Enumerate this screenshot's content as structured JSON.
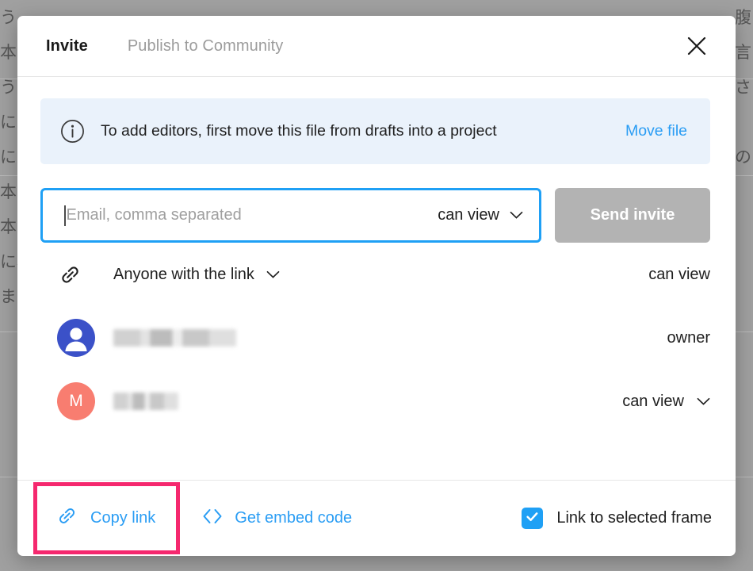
{
  "backdrop": {
    "left_text": "う\n本え\nう\nに口\nにい\n本\n本自\nに、\nま",
    "right_text": "腹\n言\nさ\n\nの",
    "overlay_color": "#a0a0a0"
  },
  "dialog": {
    "tabs": [
      {
        "label": "Invite",
        "active": true
      },
      {
        "label": "Publish to Community",
        "active": false
      }
    ],
    "close_label": "Close",
    "banner": {
      "icon": "info-icon",
      "text": "To add editors, first move this file from drafts into a project",
      "link_label": "Move file",
      "background": "#eaf2fb",
      "link_color": "#2a9df4"
    },
    "invite": {
      "placeholder": "Email, comma separated",
      "value": "",
      "permission": "can view",
      "send_label": "Send invite",
      "send_disabled": true,
      "focus_color": "#1fa0f5",
      "send_color": "#b3b3b3"
    },
    "share_rows": [
      {
        "kind": "link",
        "icon": "link-icon",
        "label": "Anyone with the link",
        "has_menu": true,
        "permission": "can view",
        "permission_has_menu": false
      },
      {
        "kind": "user",
        "icon": "person-avatar-icon",
        "avatar_color": "#3b51c8",
        "avatar_initial": "",
        "label": "",
        "redacted": true,
        "has_menu": false,
        "permission": "owner",
        "permission_has_menu": false
      },
      {
        "kind": "user",
        "icon": "initial-avatar",
        "avatar_color": "#f87d70",
        "avatar_initial": "M",
        "label": "",
        "redacted": true,
        "has_menu": false,
        "permission": "can view",
        "permission_has_menu": true
      }
    ],
    "footer": {
      "copy_link_label": "Copy link",
      "copy_link_icon": "link-icon",
      "copy_link_highlight_color": "#f5286e",
      "embed_label": "Get embed code",
      "embed_icon": "code-brackets-icon",
      "frame_checkbox_label": "Link to selected frame",
      "frame_checkbox_checked": true,
      "checkbox_color": "#1fa0f5",
      "link_color": "#2a9df4"
    }
  }
}
